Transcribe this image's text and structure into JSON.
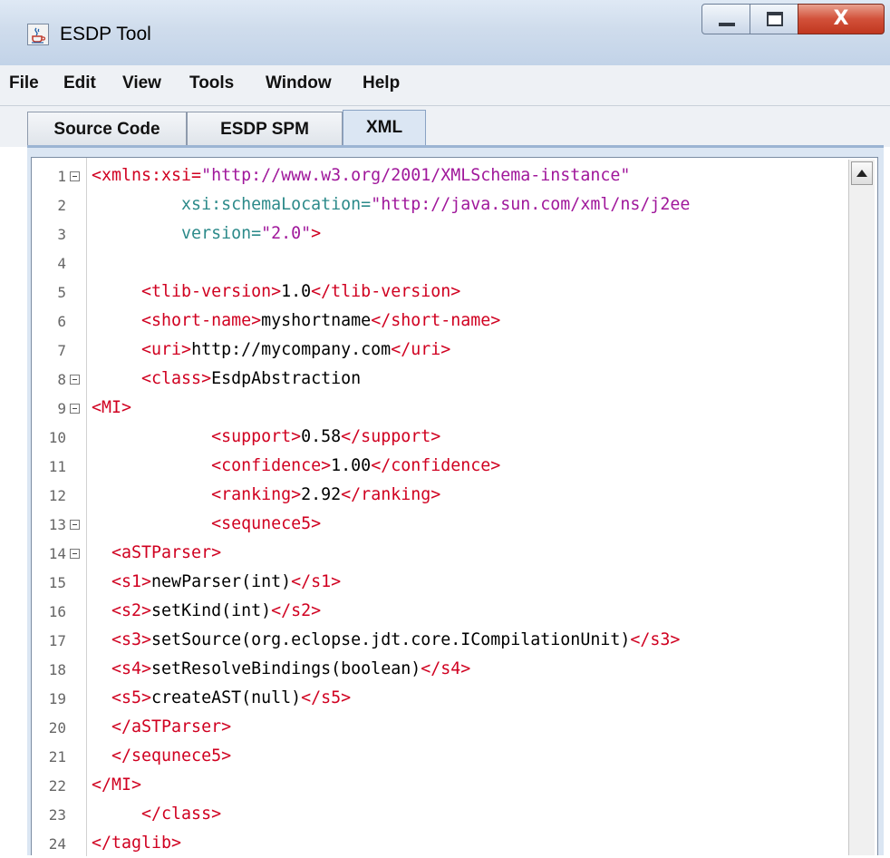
{
  "window": {
    "title": "ESDP Tool",
    "icon": "java-cup-icon",
    "close_glyph": "X"
  },
  "menubar": {
    "items": [
      "File",
      "Edit",
      "View",
      "Tools",
      "Window",
      "Help"
    ]
  },
  "tabs": [
    {
      "label": "Source Code",
      "active": false
    },
    {
      "label": "ESDP SPM",
      "active": false
    },
    {
      "label": "XML",
      "active": true
    }
  ],
  "editor": {
    "language": "XML",
    "lines": [
      {
        "n": "1",
        "fold": true,
        "segs": [
          {
            "t": "<xmlns:xsi=",
            "c": "tag"
          },
          {
            "t": "\"http://www.w3.org/2001/XMLSchema-instance\"",
            "c": "val"
          }
        ]
      },
      {
        "n": "2",
        "fold": false,
        "segs": [
          {
            "t": "         xsi:schemaLocation=",
            "c": "attr"
          },
          {
            "t": "\"http://java.sun.com/xml/ns/j2ee",
            "c": "val"
          }
        ]
      },
      {
        "n": "3",
        "fold": false,
        "segs": [
          {
            "t": "         version=",
            "c": "attr"
          },
          {
            "t": "\"2.0\"",
            "c": "val"
          },
          {
            "t": ">",
            "c": "tag"
          }
        ]
      },
      {
        "n": "4",
        "fold": false,
        "segs": []
      },
      {
        "n": "5",
        "fold": false,
        "segs": [
          {
            "t": "     <tlib-version>",
            "c": "tag"
          },
          {
            "t": "1.0",
            "c": "content"
          },
          {
            "t": "</tlib-version>",
            "c": "tag"
          }
        ]
      },
      {
        "n": "6",
        "fold": false,
        "segs": [
          {
            "t": "     <short-name>",
            "c": "tag"
          },
          {
            "t": "myshortname",
            "c": "content"
          },
          {
            "t": "</short-name>",
            "c": "tag"
          }
        ]
      },
      {
        "n": "7",
        "fold": false,
        "segs": [
          {
            "t": "     <uri>",
            "c": "tag"
          },
          {
            "t": "http://mycompany.com",
            "c": "content"
          },
          {
            "t": "</uri>",
            "c": "tag"
          }
        ]
      },
      {
        "n": "8",
        "fold": true,
        "segs": [
          {
            "t": "     <class>",
            "c": "tag"
          },
          {
            "t": "EsdpAbstraction",
            "c": "content"
          }
        ]
      },
      {
        "n": "9",
        "fold": true,
        "segs": [
          {
            "t": "<MI>",
            "c": "tag"
          }
        ]
      },
      {
        "n": "10",
        "fold": false,
        "segs": [
          {
            "t": "            <support>",
            "c": "tag"
          },
          {
            "t": "0.58",
            "c": "content"
          },
          {
            "t": "</support>",
            "c": "tag"
          }
        ]
      },
      {
        "n": "11",
        "fold": false,
        "segs": [
          {
            "t": "            <confidence>",
            "c": "tag"
          },
          {
            "t": "1.00",
            "c": "content"
          },
          {
            "t": "</confidence>",
            "c": "tag"
          }
        ]
      },
      {
        "n": "12",
        "fold": false,
        "segs": [
          {
            "t": "            <ranking>",
            "c": "tag"
          },
          {
            "t": "2.92",
            "c": "content"
          },
          {
            "t": "</ranking>",
            "c": "tag"
          }
        ]
      },
      {
        "n": "13",
        "fold": true,
        "segs": [
          {
            "t": "            <sequnece5>",
            "c": "tag"
          }
        ]
      },
      {
        "n": "14",
        "fold": true,
        "segs": [
          {
            "t": "  <aSTParser>",
            "c": "tag"
          }
        ]
      },
      {
        "n": "15",
        "fold": false,
        "segs": [
          {
            "t": "  <s1>",
            "c": "tag"
          },
          {
            "t": "newParser(int)",
            "c": "content"
          },
          {
            "t": "</s1>",
            "c": "tag"
          }
        ]
      },
      {
        "n": "16",
        "fold": false,
        "segs": [
          {
            "t": "  <s2>",
            "c": "tag"
          },
          {
            "t": "setKind(int)",
            "c": "content"
          },
          {
            "t": "</s2>",
            "c": "tag"
          }
        ]
      },
      {
        "n": "17",
        "fold": false,
        "segs": [
          {
            "t": "  <s3>",
            "c": "tag"
          },
          {
            "t": "setSource(org.eclopse.jdt.core.ICompilationUnit)",
            "c": "content"
          },
          {
            "t": "</s3>",
            "c": "tag"
          }
        ]
      },
      {
        "n": "18",
        "fold": false,
        "segs": [
          {
            "t": "  <s4>",
            "c": "tag"
          },
          {
            "t": "setResolveBindings(boolean)",
            "c": "content"
          },
          {
            "t": "</s4>",
            "c": "tag"
          }
        ]
      },
      {
        "n": "19",
        "fold": false,
        "segs": [
          {
            "t": "  <s5>",
            "c": "tag"
          },
          {
            "t": "createAST(null)",
            "c": "content"
          },
          {
            "t": "</s5>",
            "c": "tag"
          }
        ]
      },
      {
        "n": "20",
        "fold": false,
        "segs": [
          {
            "t": "  </aSTParser>",
            "c": "tag"
          }
        ]
      },
      {
        "n": "21",
        "fold": false,
        "segs": [
          {
            "t": "  </sequnece5>",
            "c": "tag"
          }
        ]
      },
      {
        "n": "22",
        "fold": false,
        "segs": [
          {
            "t": "</MI>",
            "c": "tag"
          }
        ]
      },
      {
        "n": "23",
        "fold": false,
        "segs": [
          {
            "t": "     </class>",
            "c": "tag"
          }
        ]
      },
      {
        "n": "24",
        "fold": false,
        "segs": [
          {
            "t": "</taglib>",
            "c": "tag"
          }
        ]
      }
    ]
  },
  "colors": {
    "tag": "#d00020",
    "attribute": "#2c8a8a",
    "value": "#a0179b",
    "text": "#000000",
    "active_tab": "#dbe6f3"
  }
}
